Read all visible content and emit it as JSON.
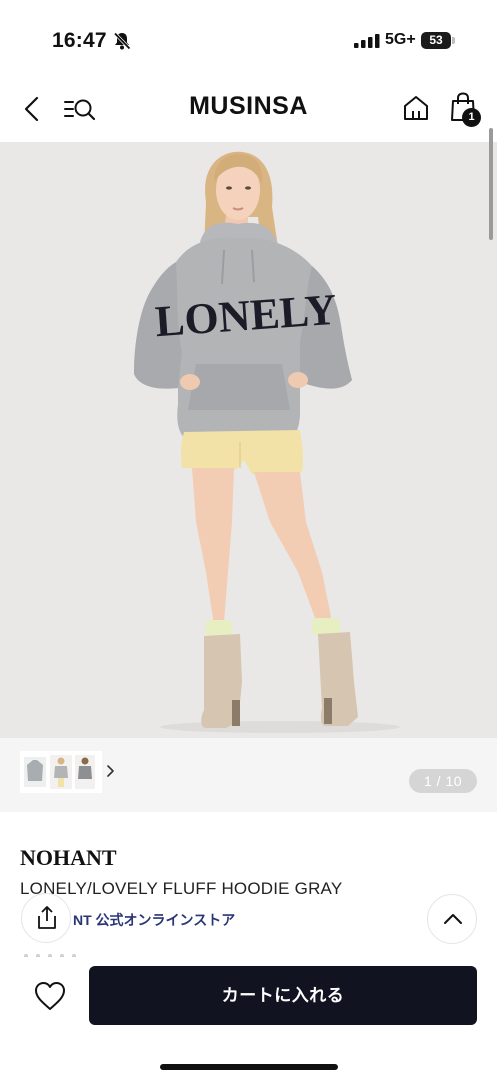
{
  "status_bar": {
    "time": "16:47",
    "network": "5G+",
    "battery_level": "53",
    "silent_icon": "bell-slash-icon",
    "signal_icon": "cellular-signal-icon"
  },
  "header": {
    "logo": "MUSINSA",
    "back_icon": "chevron-left-icon",
    "menu_search_icon": "menu-search-icon",
    "home_icon": "home-icon",
    "cart_icon": "shopping-bag-icon",
    "cart_count": "1"
  },
  "gallery": {
    "page_indicator": "1 / 10",
    "current_page": 1,
    "total_pages": 10,
    "image_subject": "model wearing gray LONELY hoodie",
    "hoodie_print": "LONELY"
  },
  "product": {
    "brand": "NOHANT",
    "title": "LONELY/LOVELY FLUFF HOODIE GRAY",
    "store_link": "NT 公式オンラインストア"
  },
  "actions": {
    "add_to_cart": "カートに入れる",
    "like_icon": "heart-icon",
    "share_icon": "share-icon",
    "scroll_top_icon": "chevron-up-icon"
  },
  "colors": {
    "primary_button": "#111420",
    "store_link": "#2a3576",
    "image_background": "#e9e8e7"
  }
}
